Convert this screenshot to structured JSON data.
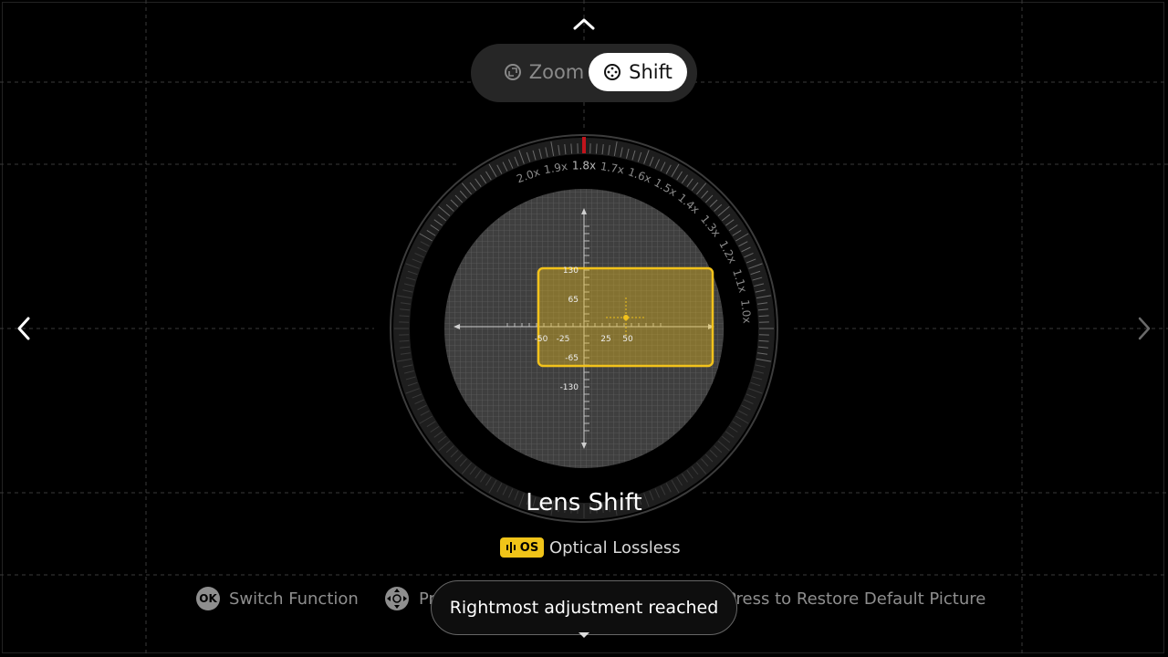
{
  "mode_switch": {
    "zoom_label": "Zoom",
    "shift_label": "Shift",
    "selected": "Shift"
  },
  "zoom_scale": {
    "labels": [
      "2.0x",
      "1.9x",
      "1.8x",
      "1.7x",
      "1.6x",
      "1.5x",
      "1.4x",
      "1.3x",
      "1.2x",
      "1.1x",
      "1.0x"
    ],
    "current": "1.8x",
    "indicator_color": "#c0141c"
  },
  "shift_chart": {
    "x_ticks": [
      "-50",
      "-25",
      "25",
      "50"
    ],
    "y_ticks": [
      "130",
      "65",
      "-65",
      "-130"
    ],
    "frame_color": "#f2c21b",
    "current_point": {
      "x": 50,
      "y": 10
    }
  },
  "title": "Lens Shift",
  "badge": {
    "icon_text": "OS",
    "label": "Optical Lossless",
    "color": "#f0c419"
  },
  "hints": {
    "switch_function": "Switch Function",
    "press_partial": "Pr",
    "restore": "Press to Restore Default Picture"
  },
  "toast": {
    "message": "Rightmost adjustment reached"
  },
  "icons": {
    "up": "chevron-up-icon",
    "left": "chevron-left-icon",
    "right": "chevron-right-icon",
    "ok": "ok-button-icon",
    "dpad": "dpad-icon"
  }
}
